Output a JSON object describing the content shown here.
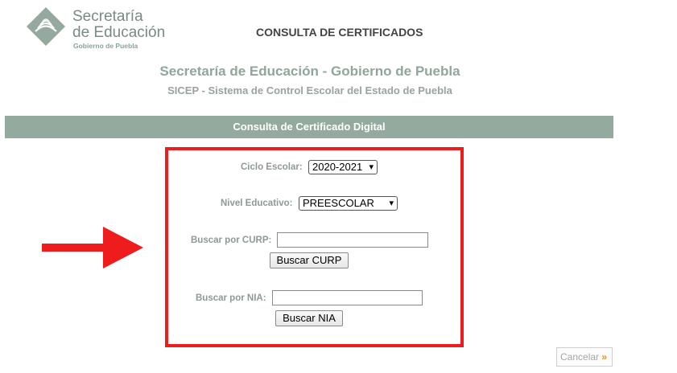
{
  "header": {
    "logo_line1": "Secretaría",
    "logo_line2": "de Educación",
    "logo_line3": "Gobierno de Puebla",
    "page_title": "CONSULTA DE CERTIFICADOS"
  },
  "org": {
    "title": "Secretaría de Educación - Gobierno de Puebla",
    "subtitle": "SICEP - Sistema de Control Escolar del Estado de Puebla"
  },
  "section": {
    "title": "Consulta de Certificado Digital"
  },
  "form": {
    "ciclo_label": "Ciclo Escolar:",
    "ciclo_value": "2020-2021",
    "nivel_label": "Nivel Educativo:",
    "nivel_value": "PREESCOLAR",
    "curp_label": "Buscar por CURP:",
    "curp_value": "",
    "curp_button": "Buscar CURP",
    "nia_label": "Buscar por NIA:",
    "nia_value": "",
    "nia_button": "Buscar NIA"
  },
  "footer": {
    "cancel_label": "Cancelar",
    "cancel_arrow": "»"
  },
  "colors": {
    "accent_green": "#94aa9e",
    "highlight_red": "#ee1c1c",
    "cancel_arrow": "#e8901f"
  },
  "icons": [
    "education-logo-icon",
    "red-arrow-icon",
    "chevron-down-icon"
  ]
}
